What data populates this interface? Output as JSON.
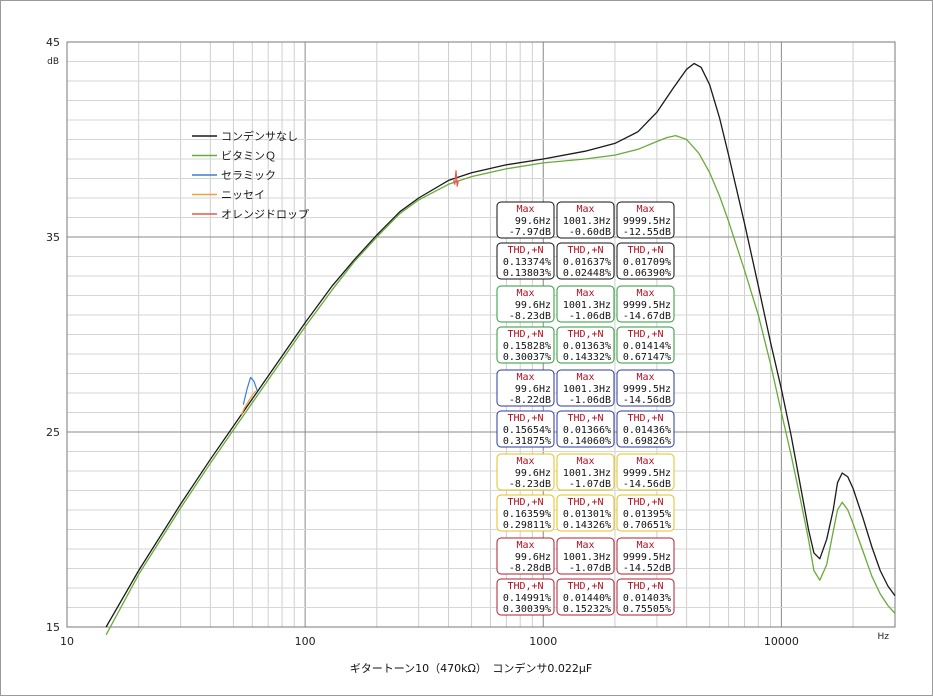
{
  "chart_data": {
    "type": "line",
    "title": "ギタートーン10（470kΩ）　コンデンサ0.022μF",
    "x_scale": "log",
    "xlim": [
      10,
      30000
    ],
    "ylim": [
      15,
      45
    ],
    "x_unit": "Hz",
    "y_unit": "dB",
    "x_ticks": [
      10,
      100,
      1000,
      10000
    ],
    "x_tick_labels": [
      "10",
      "100",
      "1000",
      "10000"
    ],
    "y_ticks": [
      15,
      25,
      35,
      45
    ],
    "y_tick_labels": [
      "15",
      "25",
      "35",
      "45"
    ],
    "grid": true,
    "legend_position": "upper-left",
    "series": [
      {
        "name": "コンデンサなし",
        "color": "#1a1a1a",
        "x": [
          14.6,
          20,
          30,
          40,
          50,
          60,
          80,
          100,
          130,
          160,
          200,
          250,
          300,
          400,
          500,
          700,
          1000,
          1500,
          2000,
          2500,
          3000,
          3500,
          4000,
          4300,
          4600,
          5000,
          5500,
          6000,
          7000,
          8000,
          9000,
          10000,
          11000,
          12000,
          13000,
          13700,
          14500,
          15500,
          16500,
          17200,
          18000,
          19000,
          20000,
          22000,
          24000,
          26000,
          28000,
          30000
        ],
        "y": [
          15.0,
          17.9,
          21.3,
          23.6,
          25.3,
          26.7,
          28.9,
          30.6,
          32.5,
          33.8,
          35.1,
          36.3,
          37.0,
          37.9,
          38.3,
          38.7,
          39.0,
          39.4,
          39.8,
          40.4,
          41.4,
          42.6,
          43.6,
          43.9,
          43.7,
          42.8,
          41.1,
          39.2,
          35.7,
          32.5,
          29.6,
          27.2,
          24.8,
          22.3,
          20.0,
          18.8,
          18.5,
          19.5,
          21.0,
          22.4,
          22.9,
          22.7,
          22.1,
          20.6,
          19.1,
          17.9,
          17.1,
          16.6
        ]
      },
      {
        "name": "ビタミンＱ",
        "color": "#6aaa3a",
        "x": [
          14.6,
          20,
          30,
          40,
          50,
          60,
          80,
          100,
          130,
          160,
          200,
          250,
          300,
          400,
          500,
          700,
          1000,
          1500,
          2000,
          2500,
          3000,
          3300,
          3600,
          4000,
          4500,
          5000,
          5500,
          6000,
          7000,
          8000,
          9000,
          10000,
          11000,
          12000,
          13000,
          13700,
          14500,
          15500,
          16500,
          17200,
          18000,
          19000,
          20000,
          22000,
          24000,
          26000,
          28000,
          30000
        ],
        "y": [
          14.6,
          17.7,
          21.1,
          23.4,
          25.1,
          26.5,
          28.7,
          30.4,
          32.3,
          33.7,
          35.0,
          36.2,
          36.9,
          37.7,
          38.1,
          38.5,
          38.8,
          39.0,
          39.2,
          39.5,
          39.9,
          40.1,
          40.2,
          40.0,
          39.3,
          38.3,
          37.1,
          35.8,
          33.3,
          31.0,
          28.5,
          26.0,
          23.8,
          21.6,
          19.5,
          17.9,
          17.4,
          18.2,
          19.9,
          21.0,
          21.4,
          21.0,
          20.3,
          18.9,
          17.6,
          16.7,
          16.1,
          15.7
        ]
      },
      {
        "name": "セラミック",
        "color": "#3a7fd0",
        "x": [
          55,
          57,
          59,
          61,
          63
        ],
        "y": [
          26.4,
          27.2,
          27.8,
          27.6,
          27.1
        ]
      },
      {
        "name": "ニッセイ",
        "color": "#f0a040",
        "x": [
          54,
          56,
          58,
          60,
          62
        ],
        "y": [
          25.9,
          26.3,
          26.6,
          26.9,
          27.1
        ]
      },
      {
        "name": "オレンジドロップ",
        "color": "#e05a4a",
        "x": [
          420,
          425,
          430,
          435,
          440
        ],
        "y": [
          37.9,
          37.7,
          38.4,
          37.6,
          37.9
        ]
      }
    ],
    "annotations": [
      {
        "color": "#111111",
        "max": [
          [
            "Max",
            "99.6Hz",
            "-7.97dB"
          ],
          [
            "Max",
            "1001.3Hz",
            "-0.60dB"
          ],
          [
            "Max",
            "9999.5Hz",
            "-12.55dB"
          ]
        ],
        "thd": [
          [
            "THD,+N",
            "0.13374%",
            "0.13803%"
          ],
          [
            "THD,+N",
            "0.01637%",
            "0.02448%"
          ],
          [
            "THD,+N",
            "0.01709%",
            "0.06390%"
          ]
        ]
      },
      {
        "color": "#2a9a3a",
        "max": [
          [
            "Max",
            "99.6Hz",
            "-8.23dB"
          ],
          [
            "Max",
            "1001.3Hz",
            "-1.06dB"
          ],
          [
            "Max",
            "9999.5Hz",
            "-14.67dB"
          ]
        ],
        "thd": [
          [
            "THD,+N",
            "0.15828%",
            "0.30037%"
          ],
          [
            "THD,+N",
            "0.01363%",
            "0.14332%"
          ],
          [
            "THD,+N",
            "0.01414%",
            "0.67147%"
          ]
        ]
      },
      {
        "color": "#2a3aa0",
        "max": [
          [
            "Max",
            "99.6Hz",
            "-8.22dB"
          ],
          [
            "Max",
            "1001.3Hz",
            "-1.06dB"
          ],
          [
            "Max",
            "9999.5Hz",
            "-14.56dB"
          ]
        ],
        "thd": [
          [
            "THD,+N",
            "0.15654%",
            "0.31875%"
          ],
          [
            "THD,+N",
            "0.01366%",
            "0.14060%"
          ],
          [
            "THD,+N",
            "0.01436%",
            "0.69826%"
          ]
        ]
      },
      {
        "color": "#e0c020",
        "max": [
          [
            "Max",
            "99.6Hz",
            "-8.23dB"
          ],
          [
            "Max",
            "1001.3Hz",
            "-1.07dB"
          ],
          [
            "Max",
            "9999.5Hz",
            "-14.56dB"
          ]
        ],
        "thd": [
          [
            "THD,+N",
            "0.16359%",
            "0.29811%"
          ],
          [
            "THD,+N",
            "0.01301%",
            "0.14326%"
          ],
          [
            "THD,+N",
            "0.01395%",
            "0.70651%"
          ]
        ]
      },
      {
        "color": "#b02030",
        "max": [
          [
            "Max",
            "99.6Hz",
            "-8.28dB"
          ],
          [
            "Max",
            "1001.3Hz",
            "-1.07dB"
          ],
          [
            "Max",
            "9999.5Hz",
            "-14.52dB"
          ]
        ],
        "thd": [
          [
            "THD,+N",
            "0.14991%",
            "0.30039%"
          ],
          [
            "THD,+N",
            "0.01440%",
            "0.15232%"
          ],
          [
            "THD,+N",
            "0.01403%",
            "0.75505%"
          ]
        ]
      }
    ],
    "annotation_head_color": "#b01020"
  }
}
